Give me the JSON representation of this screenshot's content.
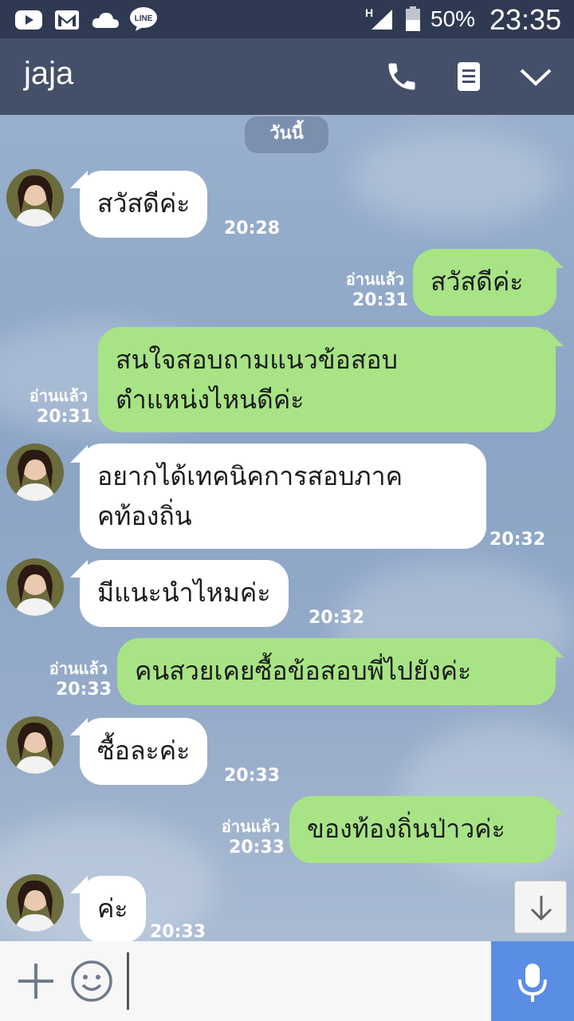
{
  "status_bar": {
    "battery_percent": "50%",
    "time": "23:35",
    "network_type": "H",
    "app_icons": [
      "youtube-icon",
      "gmail-icon",
      "cloud-icon",
      "line-icon"
    ]
  },
  "header": {
    "contact_name": "jaja",
    "icons": [
      "phone-icon",
      "notes-icon",
      "chevron-down-icon"
    ]
  },
  "chat": {
    "date_label": "วันนี้",
    "messages": [
      {
        "direction": "in",
        "text": "สวัสดีค่ะ",
        "time": "20:28"
      },
      {
        "direction": "out",
        "text": "สวัสดีค่ะ",
        "read": "อ่านแล้ว",
        "time": "20:31"
      },
      {
        "direction": "out",
        "lines": [
          "สนใจสอบถามแนวข้อสอบ",
          "ตำแหน่งไหนดีค่ะ"
        ],
        "read": "อ่านแล้ว",
        "time": "20:31"
      },
      {
        "direction": "in",
        "lines": [
          "อยากได้เทคนิคการสอบภาค",
          "คท้องถิ่น"
        ],
        "time": "20:32"
      },
      {
        "direction": "in",
        "text": "มีแนะนำไหมค่ะ",
        "time": "20:32"
      },
      {
        "direction": "out",
        "text": "คนสวยเคยซื้อข้อสอบพี่ไปยังค่ะ",
        "read": "อ่านแล้ว",
        "time": "20:33"
      },
      {
        "direction": "in",
        "text": "ซื้อละค่ะ",
        "time": "20:33"
      },
      {
        "direction": "out",
        "text": "ของท้องถิ่นป่าวค่ะ",
        "read": "อ่านแล้ว",
        "time": "20:33"
      },
      {
        "direction": "in",
        "text": "ค่ะ",
        "time": "20:33"
      }
    ]
  },
  "input_bar": {
    "icons": [
      "plus-icon",
      "emoji-icon",
      "microphone-icon"
    ],
    "value": ""
  },
  "colors": {
    "status_bar": "#2f3a52",
    "header": "#445069",
    "incoming_bubble": "#ffffff",
    "outgoing_bubble": "#a8e486",
    "mic_button": "#5a8de4"
  }
}
